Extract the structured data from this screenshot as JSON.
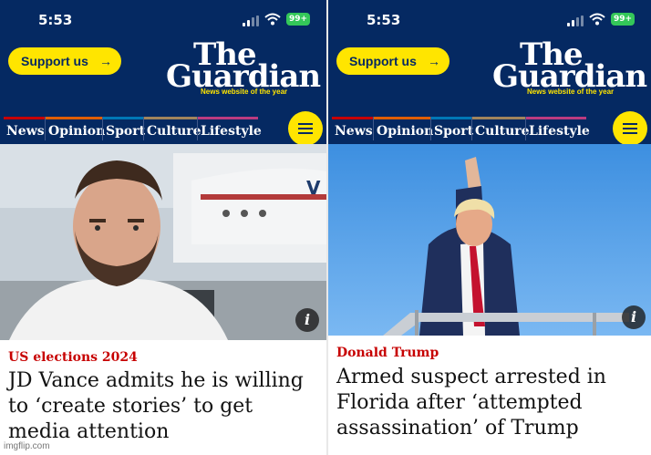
{
  "left": {
    "status_time": "5:53",
    "battery": "99+",
    "support_label": "Support us",
    "logo_the": "The",
    "logo_guardian": "Guardian",
    "logo_tagline": "News website of the year",
    "nav": [
      "News",
      "Opinion",
      "Sport",
      "Culture",
      "Lifestyle"
    ],
    "info_label": "i",
    "kicker": "US elections 2024",
    "headline_lines": [
      "JD Vance admits he is willing",
      "to ‘create stories’ to get",
      "media attention"
    ]
  },
  "right": {
    "status_time": "5:53",
    "battery": "99+",
    "support_label": "Support us",
    "logo_the": "The",
    "logo_guardian": "Guardian",
    "logo_tagline": "News website of the year",
    "nav": [
      "News",
      "Opinion",
      "Sport",
      "Culture",
      "Lifestyle"
    ],
    "info_label": "i",
    "kicker": "Donald Trump",
    "headline_lines": [
      "Armed suspect arrested in",
      "Florida after ‘attempted",
      "assassination’ of Trump"
    ]
  },
  "watermark": "imgflip.com",
  "colors": {
    "brand_navy": "#052962",
    "support_yellow": "#ffe500",
    "kicker_red": "#c70000",
    "nav_news": "#c70000",
    "nav_opinion": "#e05e00",
    "nav_sport": "#0077b6",
    "nav_culture": "#a1845c",
    "nav_lifestyle": "#bb3b80"
  }
}
